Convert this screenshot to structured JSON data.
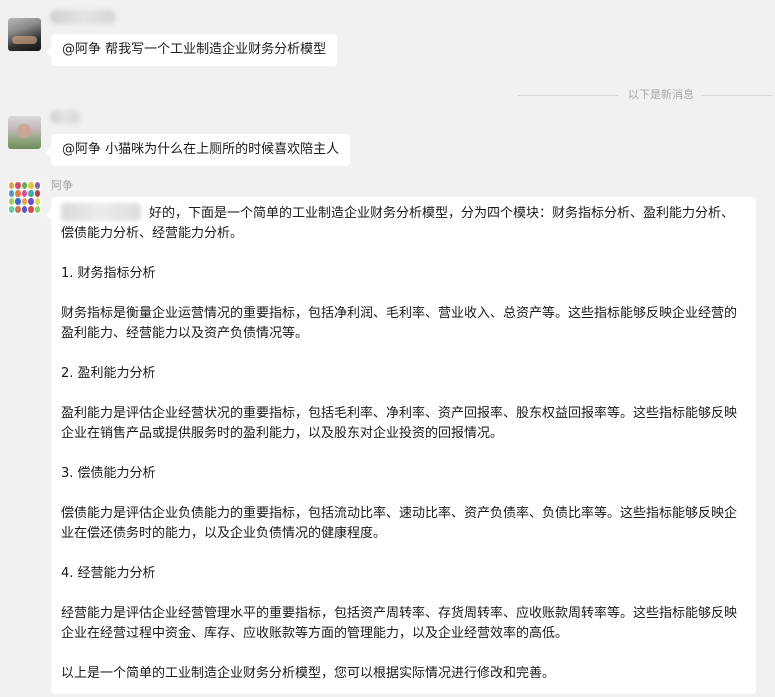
{
  "messages": [
    {
      "text": "@阿争 帮我写一个工业制造企业财务分析模型"
    },
    {
      "text": "@阿争 小猫咪为什么在上厕所的时候喜欢陪主人"
    }
  ],
  "divider": {
    "label": "以下是新消息"
  },
  "reply": {
    "sender": "阿争",
    "intro": "好的，下面是一个简单的工业制造企业财务分析模型，分为四个模块：财务指标分析、盈利能力分析、偿债能力分析、经营能力分析。",
    "sections": [
      {
        "heading": "1. 财务指标分析",
        "body": "财务指标是衡量企业运营情况的重要指标，包括净利润、毛利率、营业收入、总资产等。这些指标能够反映企业经营的盈利能力、经营能力以及资产负债情况等。"
      },
      {
        "heading": "2. 盈利能力分析",
        "body": "盈利能力是评估企业经营状况的重要指标，包括毛利率、净利率、资产回报率、股东权益回报率等。这些指标能够反映企业在销售产品或提供服务时的盈利能力，以及股东对企业投资的回报情况。"
      },
      {
        "heading": "3. 偿债能力分析",
        "body": "偿债能力是评估企业负债能力的重要指标，包括流动比率、速动比率、资产负债率、负债比率等。这些指标能够反映企业在偿还债务时的能力，以及企业负债情况的健康程度。"
      },
      {
        "heading": "4. 经营能力分析",
        "body": "经营能力是评估企业经营管理水平的重要指标，包括资产周转率、存货周转率、应收账款周转率等。这些指标能够反映企业在经营过程中资金、库存、应收账款等方面的管理能力，以及企业经营效率的高低。"
      }
    ],
    "closing": "以上是一个简单的工业制造企业财务分析模型，您可以根据实际情况进行修改和完善。"
  }
}
